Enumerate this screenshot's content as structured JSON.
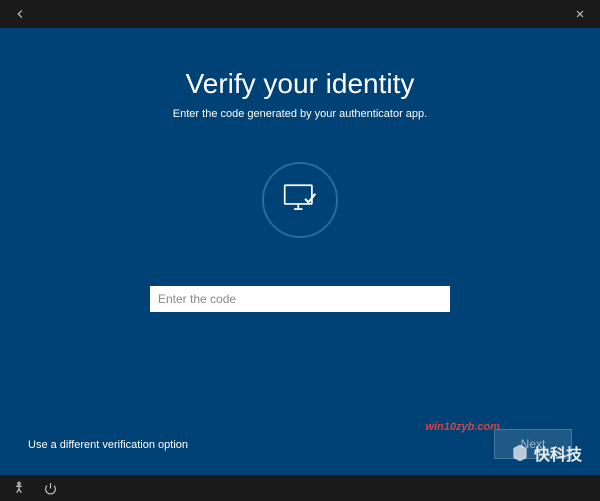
{
  "header": {
    "title": "Verify your identity",
    "subtitle": "Enter the code generated by your authenticator app."
  },
  "form": {
    "code_placeholder": "Enter the code",
    "code_value": ""
  },
  "actions": {
    "alt_option_label": "Use a different verification option",
    "next_label": "Next"
  },
  "watermarks": {
    "text1": "win10zyb.com",
    "text2": "快科技"
  },
  "colors": {
    "background": "#004275",
    "titlebar": "#1a1a1a",
    "text": "#ffffff"
  }
}
